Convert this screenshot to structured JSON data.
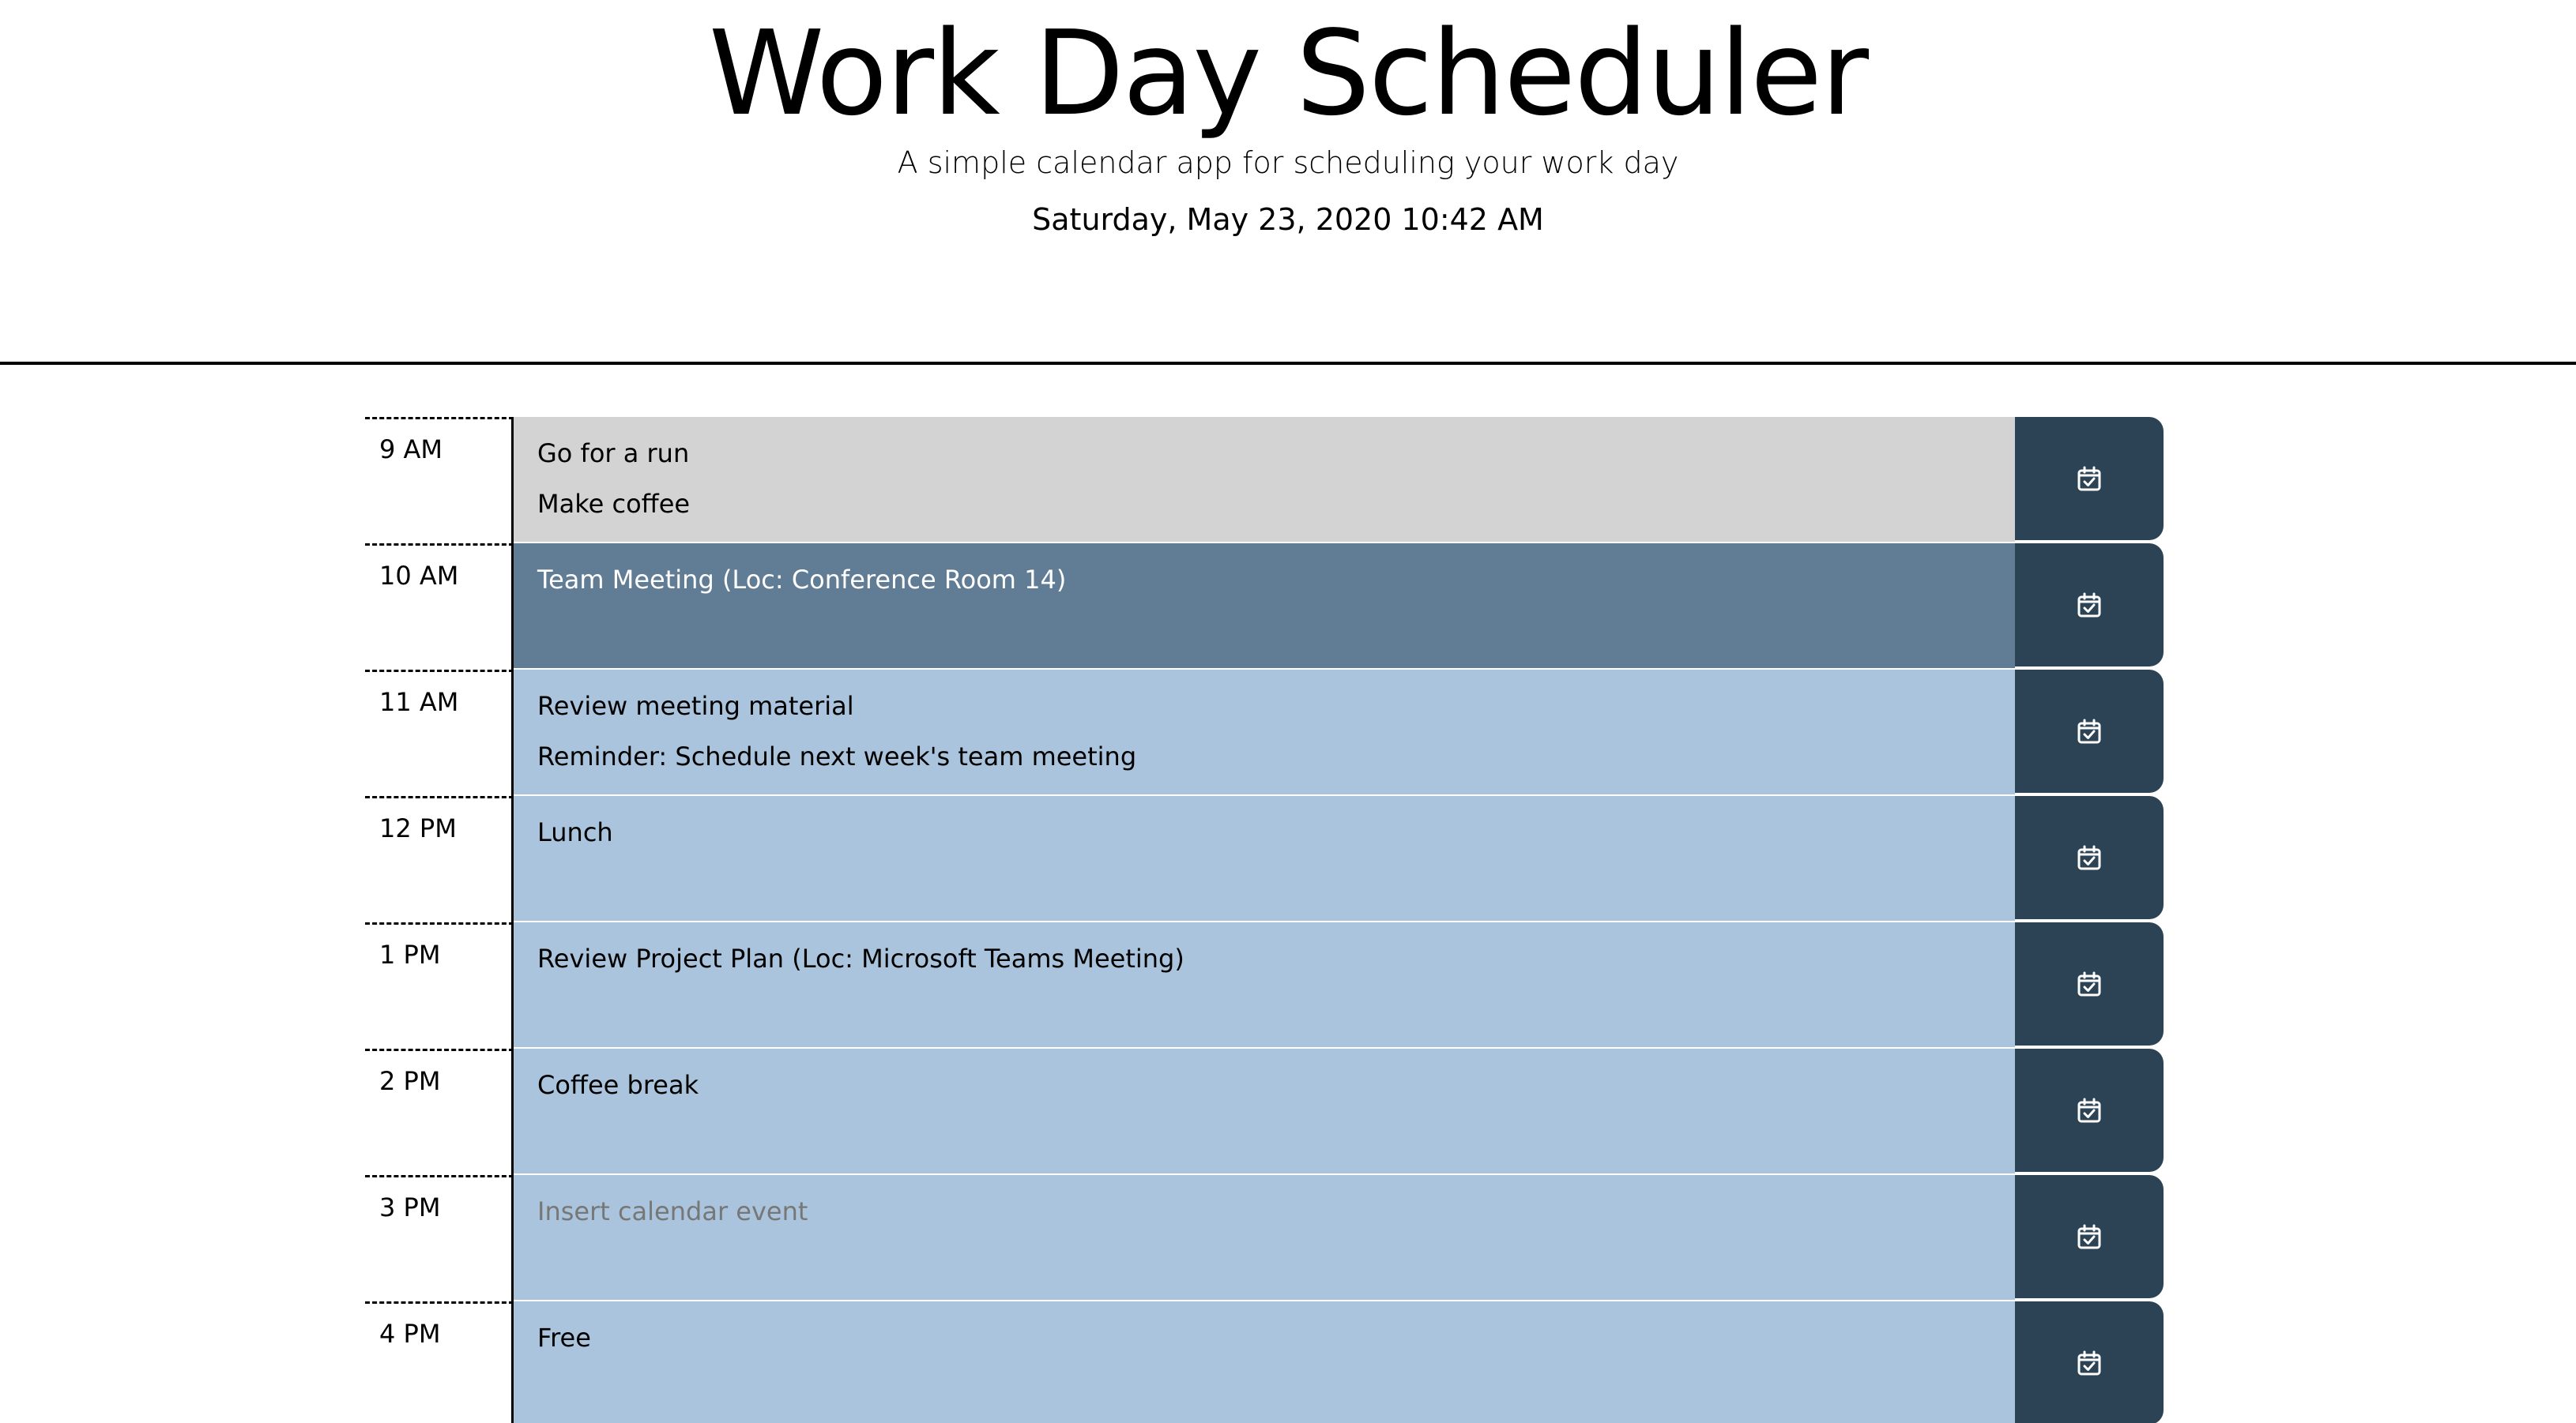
{
  "header": {
    "title": "Work Day Scheduler",
    "subtitle": "A simple calendar app for scheduling your work day",
    "current_date": "Saturday, May 23, 2020 10:42 AM"
  },
  "schedule": {
    "save_icon": "calendar-check-icon",
    "colors": {
      "past": "#d3d3d3",
      "present": "#617d96",
      "future": "#a9c4dc",
      "save_button": "#2c4356"
    },
    "rows": [
      {
        "hour": "9 AM",
        "state": "past",
        "lines": [
          "Go for a run",
          "Make coffee"
        ],
        "placeholder": ""
      },
      {
        "hour": "10 AM",
        "state": "present",
        "lines": [
          "Team Meeting (Loc: Conference Room 14)"
        ],
        "placeholder": ""
      },
      {
        "hour": "11 AM",
        "state": "future",
        "lines": [
          "Review meeting material",
          "Reminder: Schedule next week's team meeting"
        ],
        "placeholder": ""
      },
      {
        "hour": "12 PM",
        "state": "future",
        "lines": [
          "Lunch"
        ],
        "placeholder": ""
      },
      {
        "hour": "1 PM",
        "state": "future",
        "lines": [
          "Review Project Plan (Loc: Microsoft Teams Meeting)"
        ],
        "placeholder": ""
      },
      {
        "hour": "2 PM",
        "state": "future",
        "lines": [
          "Coffee break"
        ],
        "placeholder": ""
      },
      {
        "hour": "3 PM",
        "state": "future",
        "lines": [],
        "placeholder": "Insert calendar event"
      },
      {
        "hour": "4 PM",
        "state": "future",
        "lines": [
          "Free"
        ],
        "placeholder": ""
      }
    ]
  }
}
